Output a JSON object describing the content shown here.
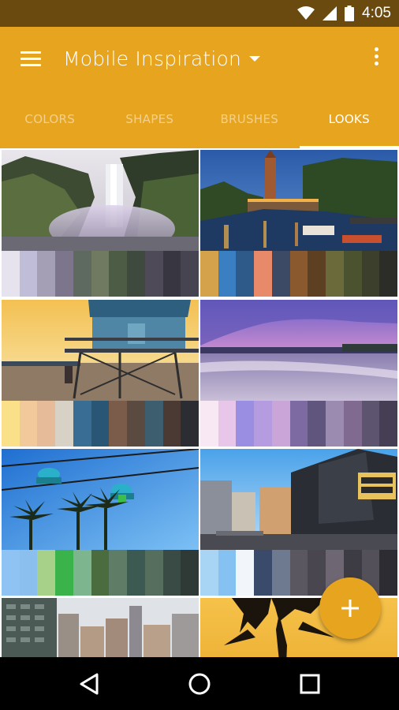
{
  "status_bar": {
    "time": "4:05",
    "icons": [
      "wifi-icon",
      "signal-icon",
      "battery-icon"
    ]
  },
  "toolbar": {
    "title": "Mobile Inspiration",
    "menu_icon": "hamburger-menu-icon",
    "dropdown_icon": "caret-down-icon",
    "overflow_icon": "more-vertical-icon"
  },
  "tabs": [
    {
      "label": "COLORS",
      "active": false
    },
    {
      "label": "SHAPES",
      "active": false
    },
    {
      "label": "BRUSHES",
      "active": false
    },
    {
      "label": "LOOKS",
      "active": true
    }
  ],
  "colors": {
    "status_bar": "#6b4a10",
    "accent": "#e7a41f",
    "tab_inactive": "#f3d08b",
    "tab_active": "#ffffff"
  },
  "looks": [
    {
      "name": "waterfall",
      "swatches": [
        "#e7e3ee",
        "#c0bdd8",
        "#a59fb6",
        "#7d758c",
        "#5e6a60",
        "#6f7a61",
        "#4d5c45",
        "#3e4a3e",
        "#4e4a57",
        "#383641",
        "#474452"
      ]
    },
    {
      "name": "canal-city-night",
      "swatches": [
        "#d4a24a",
        "#3a7fc2",
        "#2e5a8a",
        "#e8896a",
        "#3c4a66",
        "#8a5a2e",
        "#5d4022",
        "#6b6a3a",
        "#4b5230",
        "#3b3f2c",
        "#2c2d29"
      ]
    },
    {
      "name": "lifeguard-tower",
      "swatches": [
        "#fbe08a",
        "#f2c99a",
        "#e6bb99",
        "#d8d2c6",
        "#3a6d93",
        "#2a5675",
        "#7b5c4a",
        "#5a4a40",
        "#3c5e6e",
        "#4a3a33",
        "#2b2d33"
      ]
    },
    {
      "name": "purple-beach",
      "swatches": [
        "#f8e8f4",
        "#e8c6e9",
        "#9a8ee3",
        "#b59be0",
        "#c9a5d8",
        "#7e6aa3",
        "#60557d",
        "#9b8bb0",
        "#806a90",
        "#5d5470",
        "#453e55"
      ]
    },
    {
      "name": "sky-ride-palms",
      "swatches": [
        "#8fc3f3",
        "#8bbfee",
        "#a7d088",
        "#39b34a",
        "#7db58f",
        "#4a6c3e",
        "#5e7c66",
        "#3c5a52",
        "#566e5e",
        "#3a4a44",
        "#2f3a36"
      ]
    },
    {
      "name": "city-street",
      "swatches": [
        "#a9d5f5",
        "#86c2f1",
        "#f2f6fa",
        "#3a4a6a",
        "#6d7a90",
        "#5a5760",
        "#4a4650",
        "#6e6672",
        "#3d3b44",
        "#54505a",
        "#2d2c33"
      ]
    },
    {
      "name": "city-skyline",
      "swatches": []
    },
    {
      "name": "palm-sunset",
      "swatches": []
    }
  ],
  "fab": {
    "icon": "add-icon"
  },
  "nav_bar": {
    "icons": [
      "back-icon",
      "home-icon",
      "recents-icon"
    ]
  }
}
